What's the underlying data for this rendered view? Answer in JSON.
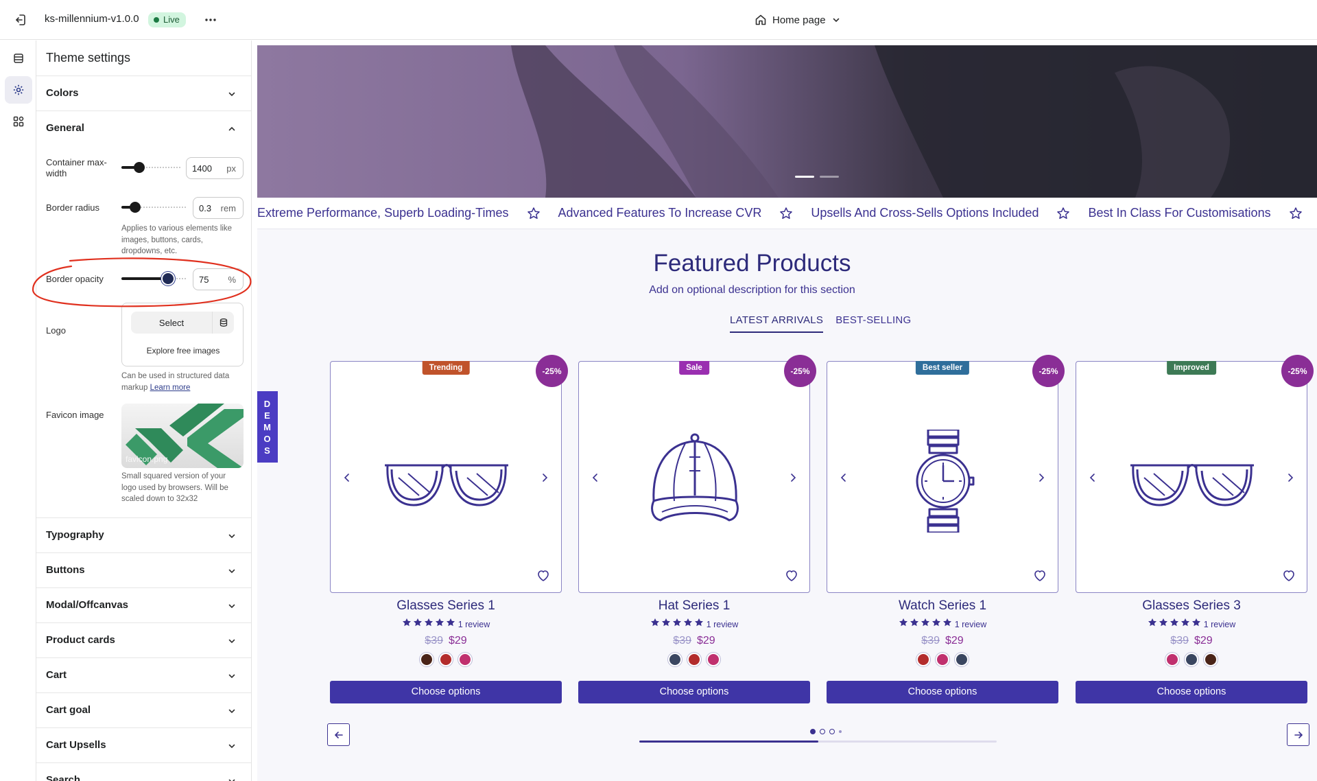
{
  "topbar": {
    "store_name": "ks-millennium-v1.0.0",
    "status": "Live",
    "page": "Home page"
  },
  "rail": {
    "items": [
      "sections-icon",
      "theme-settings-icon",
      "apps-icon"
    ],
    "active": 1
  },
  "panel": {
    "title": "Theme settings",
    "sections_top": [
      {
        "label": "Colors",
        "expanded": false
      },
      {
        "label": "General",
        "expanded": true
      }
    ],
    "general": {
      "container": {
        "label_line1": "Container max-",
        "label_line2": "width",
        "value": "1400",
        "unit": "px",
        "level": 0.3
      },
      "radius": {
        "label": "Border radius",
        "value": "0.3",
        "unit": "rem",
        "level": 0.2,
        "help_line1": "Applies to various elements like",
        "help_line2": "images, buttons, cards,",
        "help_line3": "dropdowns, etc."
      },
      "opacity": {
        "label": "Border opacity",
        "value": "75",
        "unit": "%",
        "level": 0.75
      },
      "logo": {
        "label": "Logo",
        "select": "Select",
        "explore": "Explore free images",
        "help_line1": "Can be used in structured data",
        "help_line2": "markup",
        "help_link": "Learn more"
      },
      "favicon": {
        "label": "Favicon image",
        "file": "favicon.png",
        "help_line1": "Small squared version of your",
        "help_line2": "logo used by browsers. Will be",
        "help_line3": "scaled down to 32x32"
      }
    },
    "sections_bottom": [
      "Typography",
      "Buttons",
      "Modal/Offcanvas",
      "Product cards",
      "Cart",
      "Cart goal",
      "Cart Upsells",
      "Search"
    ]
  },
  "preview": {
    "marquee": [
      "Extreme Performance, Superb Loading-Times",
      "Advanced Features To Increase CVR",
      "Upsells And Cross-Sells Options Included",
      "Best In Class For Customisations"
    ],
    "title": "Featured Products",
    "description": "Add on optional description for this section",
    "tabs": [
      "LATEST ARRIVALS",
      "BEST-SELLING"
    ],
    "demos": [
      "D",
      "E",
      "M",
      "O",
      "S"
    ],
    "products": [
      {
        "name": "Glasses Series 1",
        "badge": "Trending",
        "badge_color": "#c0532b",
        "discount": "-25%",
        "reviews": "1 review",
        "old_price": "$39",
        "price": "$29",
        "rating": 5,
        "icon": "glasses",
        "swatches": [
          "#4a2418",
          "#b32c2c",
          "#c0306e"
        ],
        "cta": "Choose options"
      },
      {
        "name": "Hat Series 1",
        "badge": "Sale",
        "badge_color": "#9a2fb0",
        "discount": "-25%",
        "reviews": "1 review",
        "old_price": "$39",
        "price": "$29",
        "rating": 5,
        "icon": "cap",
        "swatches": [
          "#3a4660",
          "#b32c2c",
          "#c0306e"
        ],
        "cta": "Choose options"
      },
      {
        "name": "Watch Series 1",
        "badge": "Best seller",
        "badge_color": "#2f6e9b",
        "discount": "-25%",
        "reviews": "1 review",
        "old_price": "$39",
        "price": "$29",
        "rating": 5,
        "icon": "watch",
        "swatches": [
          "#b32c2c",
          "#c0306e",
          "#3a4660"
        ],
        "cta": "Choose options"
      },
      {
        "name": "Glasses Series 3",
        "badge": "Improved",
        "badge_color": "#3d7a55",
        "discount": "-25%",
        "reviews": "1 review",
        "old_price": "$39",
        "price": "$29",
        "rating": 5,
        "icon": "glasses",
        "swatches": [
          "#c0306e",
          "#3a4660",
          "#4a2418"
        ],
        "cta": "Choose options"
      }
    ],
    "pager": {
      "pages": 4,
      "current": 1,
      "progress": 0.5
    }
  },
  "colors": {
    "accent": "#3f35a6",
    "heading": "#2d2a7a",
    "discount": "#8a2e96",
    "annotation": "#e0301e"
  }
}
